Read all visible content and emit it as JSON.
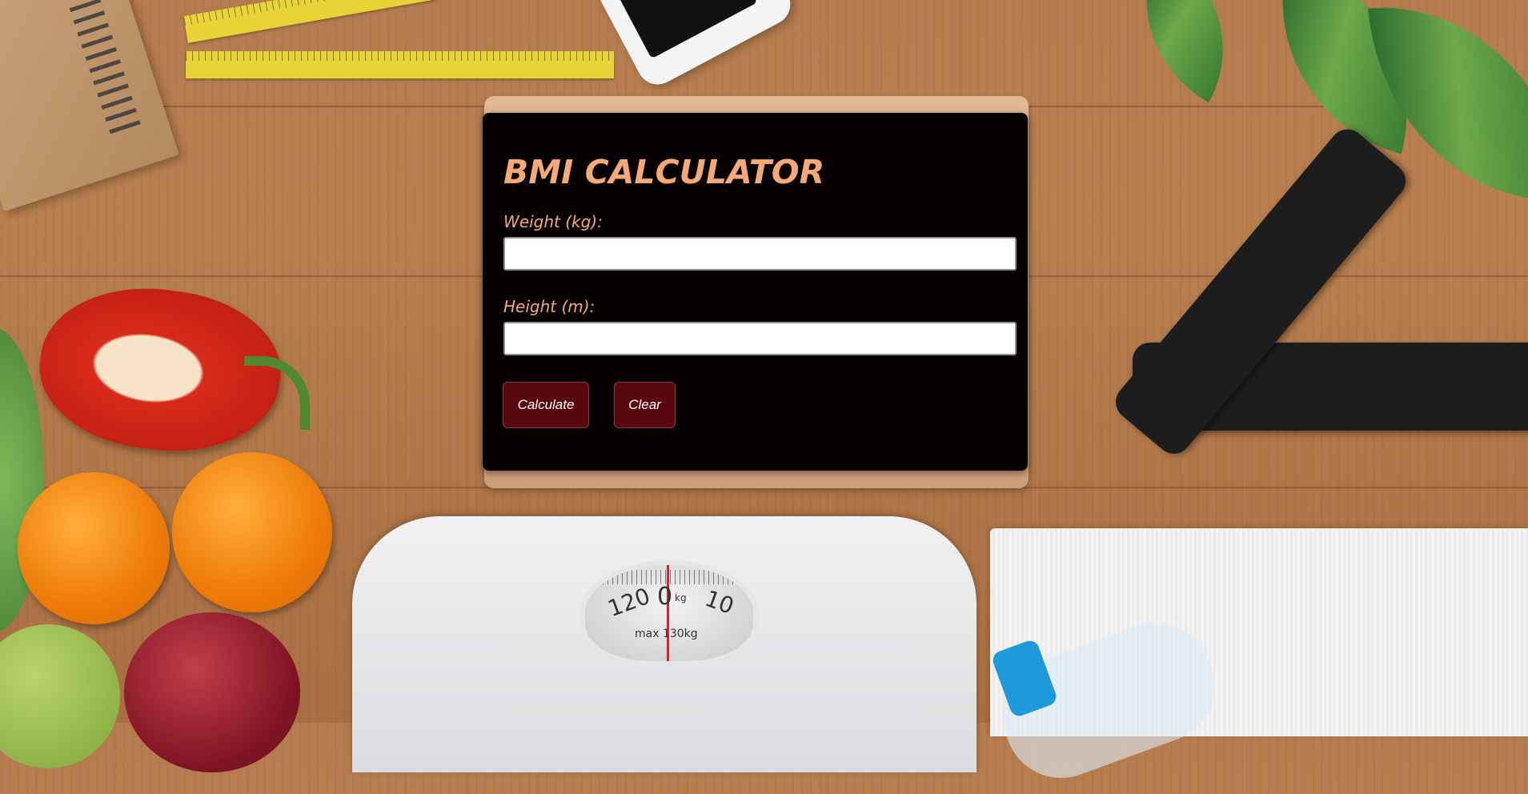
{
  "calculator": {
    "title": "BMI CALCULATOR",
    "weight_label": "Weight (kg):",
    "weight_value": "",
    "height_label": "Height (m):",
    "height_value": "",
    "calculate_label": "Calculate",
    "clear_label": "Clear"
  },
  "colors": {
    "card_background": "#070000",
    "accent_text": "#f4a977",
    "button_background": "#58070f",
    "button_text": "#ffffff"
  },
  "background": {
    "scale_dial": {
      "left_number": "120",
      "center_number": "0",
      "unit": "kg",
      "right_number": "10",
      "max_text": "max 130kg"
    }
  }
}
